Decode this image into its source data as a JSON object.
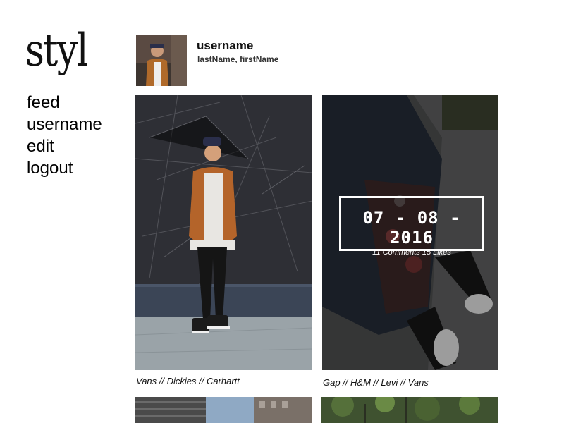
{
  "app": {
    "logo": "styl"
  },
  "nav": {
    "items": [
      {
        "label": "feed"
      },
      {
        "label": "username"
      },
      {
        "label": "edit"
      },
      {
        "label": "logout"
      }
    ]
  },
  "profile": {
    "username": "username",
    "full_name": "lastName, firstName"
  },
  "posts": [
    {
      "caption": "Vans // Dickies // Carhartt"
    },
    {
      "caption": "Gap // H&M // Levi // Vans",
      "date": "07 - 08 - 2016",
      "stats": "11 Comments 15 Likes"
    },
    {
      "caption": ""
    },
    {
      "caption": ""
    }
  ],
  "colors": {
    "background": "#ffffff",
    "text": "#111111",
    "overlay_border": "#ffffff"
  }
}
